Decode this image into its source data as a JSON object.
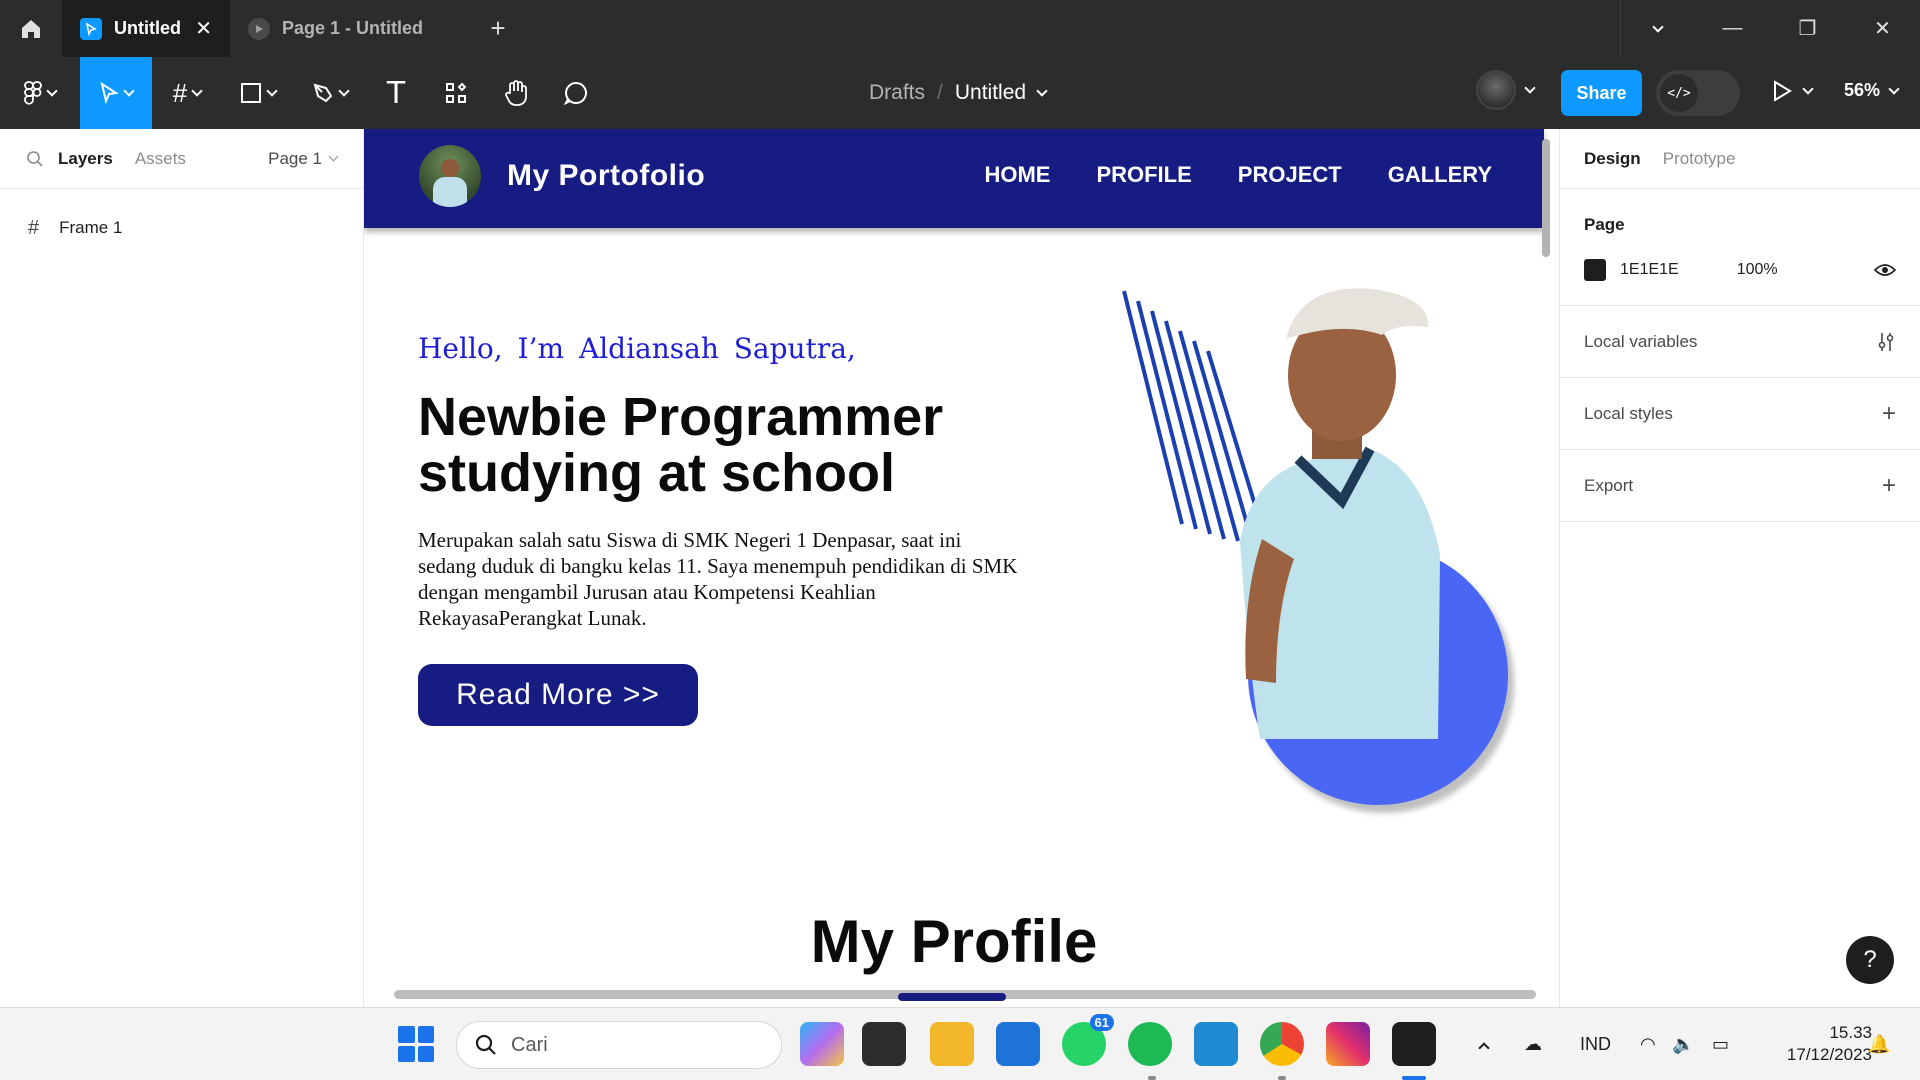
{
  "titlebar": {
    "tabs": [
      {
        "label": "Untitled",
        "active": true
      },
      {
        "label": "Page 1 - Untitled",
        "active": false
      }
    ]
  },
  "toolbar": {
    "breadcrumb": {
      "parent": "Drafts",
      "separator": "/",
      "file": "Untitled"
    },
    "share_label": "Share",
    "zoom": "56%"
  },
  "left_panel": {
    "tabs": {
      "layers": "Layers",
      "assets": "Assets"
    },
    "page_selector": "Page 1",
    "layers": [
      {
        "name": "Frame 1",
        "icon": "frame-icon"
      }
    ]
  },
  "canvas": {
    "site": {
      "title": "My Portofolio",
      "menu": [
        "HOME",
        "PROFILE",
        "PROJECT",
        "GALLERY"
      ],
      "hello": "Hello, I’m Aldiansah Saputra,",
      "headline": "Newbie Programmer studying at school",
      "description": "Merupakan salah satu Siswa di SMK Negeri 1 Denpasar, saat ini sedang duduk di bangku kelas 11. Saya menempuh pendidikan di SMK dengan mengambil Jurusan atau Kompetensi Keahlian RekayasaPerangkat Lunak.",
      "button": "Read More >>",
      "profile_heading": "My Profile"
    },
    "colors": {
      "nav": "#171c82",
      "accent_blue": "#4a66f5",
      "hello": "#1e1ed6"
    }
  },
  "right_panel": {
    "tabs": {
      "design": "Design",
      "prototype": "Prototype"
    },
    "page_section": {
      "title": "Page",
      "fill_hex": "1E1E1E",
      "opacity": "100%"
    },
    "rows": [
      "Local variables",
      "Local styles",
      "Export"
    ]
  },
  "taskbar": {
    "search_placeholder": "Cari",
    "whatsapp_badge": "61",
    "language": "IND",
    "time": "15.33",
    "date": "17/12/2023"
  }
}
